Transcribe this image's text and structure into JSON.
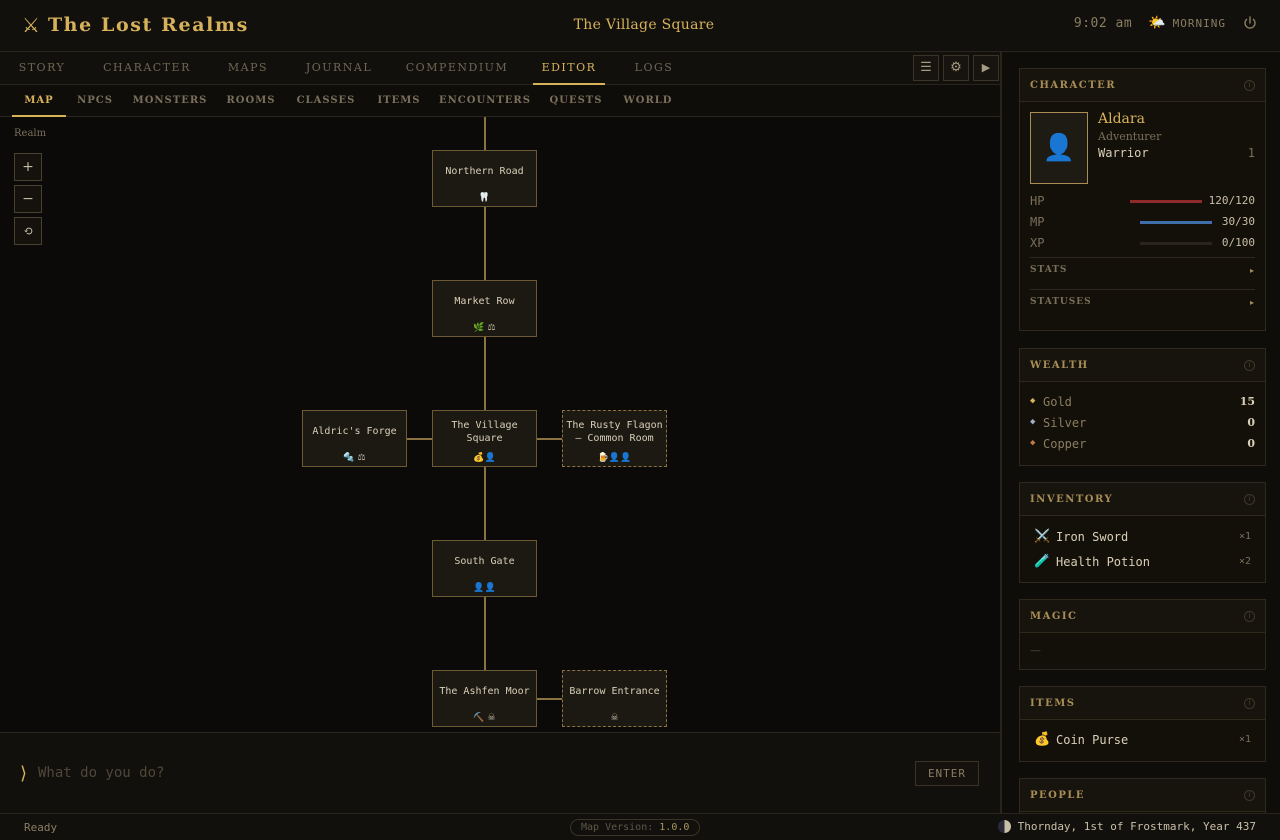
{
  "app": {
    "title": "The Lost Realms",
    "location": "The Village Square",
    "time": "9:02 am",
    "time_of_day": "MORNING"
  },
  "main_tabs": [
    {
      "label": "STORY"
    },
    {
      "label": "CHARACTER"
    },
    {
      "label": "MAPS"
    },
    {
      "label": "JOURNAL"
    },
    {
      "label": "COMPENDIUM"
    },
    {
      "label": "EDITOR"
    },
    {
      "label": "LOGS"
    }
  ],
  "main_tabs_active": "EDITOR",
  "sub_tabs": [
    {
      "label": "MAP"
    },
    {
      "label": "NPCS"
    },
    {
      "label": "MONSTERS"
    },
    {
      "label": "ROOMS"
    },
    {
      "label": "CLASSES"
    },
    {
      "label": "ITEMS"
    },
    {
      "label": "ENCOUNTERS"
    },
    {
      "label": "QUESTS"
    },
    {
      "label": "WORLD"
    }
  ],
  "sub_tabs_active": "MAP",
  "map": {
    "realm_label": "Realm",
    "zoom_in": "+",
    "zoom_out": "−",
    "reset": "⟲",
    "nodes": {
      "northern_road": {
        "name": "Northern Road",
        "icons": "🦷"
      },
      "market_row": {
        "name": "Market Row",
        "icons": "🌿 ⚖"
      },
      "aldrics_forge": {
        "name": "Aldric's Forge",
        "icons": "🔩 ⚖"
      },
      "village_square": {
        "name": "The Village Square",
        "icons": "💰👤"
      },
      "rusty_flagon": {
        "name": "The Rusty Flagon — Common Room",
        "icons": "🍺👤👤"
      },
      "south_gate": {
        "name": "South Gate",
        "icons": "👤👤"
      },
      "ashfen_moor": {
        "name": "The Ashfen Moor",
        "icons": "⛏️ ☠"
      },
      "barrow_entrance": {
        "name": "Barrow Entrance",
        "icons": "☠"
      }
    }
  },
  "command": {
    "prompt": "⟩",
    "placeholder": "What do you do?",
    "enter_label": "ENTER"
  },
  "status": {
    "text": "Ready",
    "map_version_label": "Map Version:",
    "map_version": "1.0.0",
    "date": "Thornday, 1st of Frostmark, Year 437"
  },
  "character": {
    "heading": "CHARACTER",
    "name": "Aldara",
    "role": "Adventurer",
    "class": "Warrior",
    "level": "1",
    "hp": {
      "label": "HP",
      "value": "120/120",
      "fraction": 1.0,
      "color": "#8e2a2a"
    },
    "mp": {
      "label": "MP",
      "value": "30/30",
      "fraction": 1.0,
      "color": "#3f6ea8"
    },
    "xp": {
      "label": "XP",
      "value": "0/100",
      "fraction": 0.0,
      "color": "#6b5a33"
    },
    "stats_label": "STATS",
    "statuses_label": "STATUSES"
  },
  "wealth": {
    "heading": "WEALTH",
    "coins": [
      {
        "name": "Gold",
        "value": "15",
        "color": "#d7b25a"
      },
      {
        "name": "Silver",
        "value": "0",
        "color": "#9fb0c8"
      },
      {
        "name": "Copper",
        "value": "0",
        "color": "#c07a45"
      }
    ]
  },
  "inventory": {
    "heading": "INVENTORY",
    "items": [
      {
        "icon": "⚔️",
        "name": "Iron Sword",
        "qty": "×1"
      },
      {
        "icon": "🧪",
        "name": "Health Potion",
        "qty": "×2"
      }
    ]
  },
  "magic": {
    "heading": "MAGIC",
    "empty": "—"
  },
  "items": {
    "heading": "ITEMS",
    "list": [
      {
        "icon": "💰",
        "name": "Coin Purse",
        "qty": "×1"
      }
    ]
  },
  "people": {
    "heading": "PEOPLE"
  },
  "icons": {
    "logo": "sword-icon",
    "weather": "sun-cloud-icon",
    "power": "power-icon",
    "menu": "☰",
    "settings": "⚙",
    "play": "▶",
    "info": "ⓘ"
  }
}
